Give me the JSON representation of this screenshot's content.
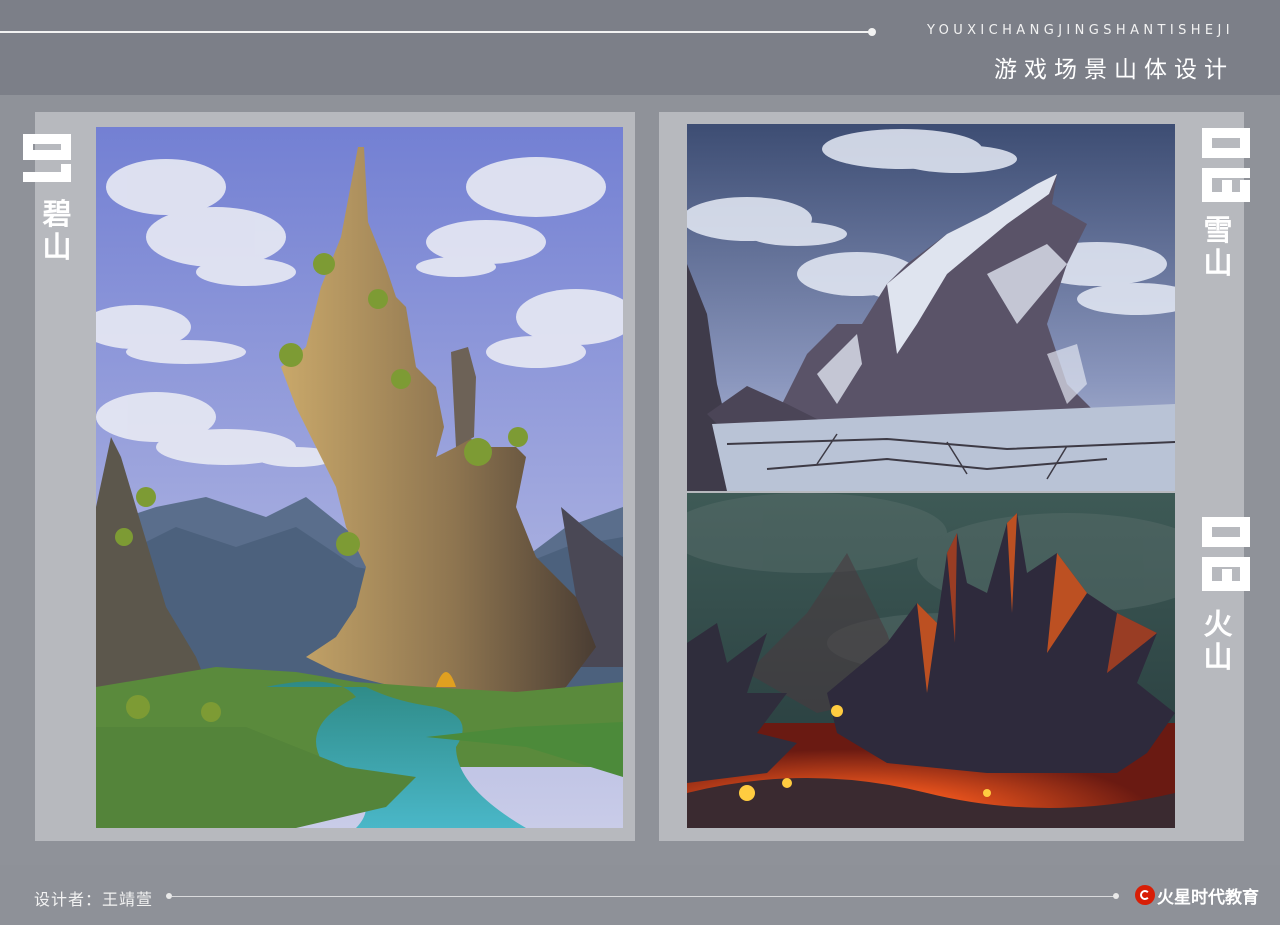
{
  "header": {
    "pinyin": "YOUXICHANGJINGSHANTISHEJI",
    "title": "游戏场景山体设计"
  },
  "sections": [
    {
      "number": "01",
      "name": "碧山"
    },
    {
      "number": "02",
      "name": "雪山"
    },
    {
      "number": "03",
      "name": "火山"
    }
  ],
  "footer": {
    "designer": "设计者：王靖萱",
    "brand": "火星时代教育"
  },
  "colors": {
    "background": "#8e9199",
    "panel": "#b7b9be",
    "text": "#ffffff",
    "brand_red": "#d81e06"
  }
}
